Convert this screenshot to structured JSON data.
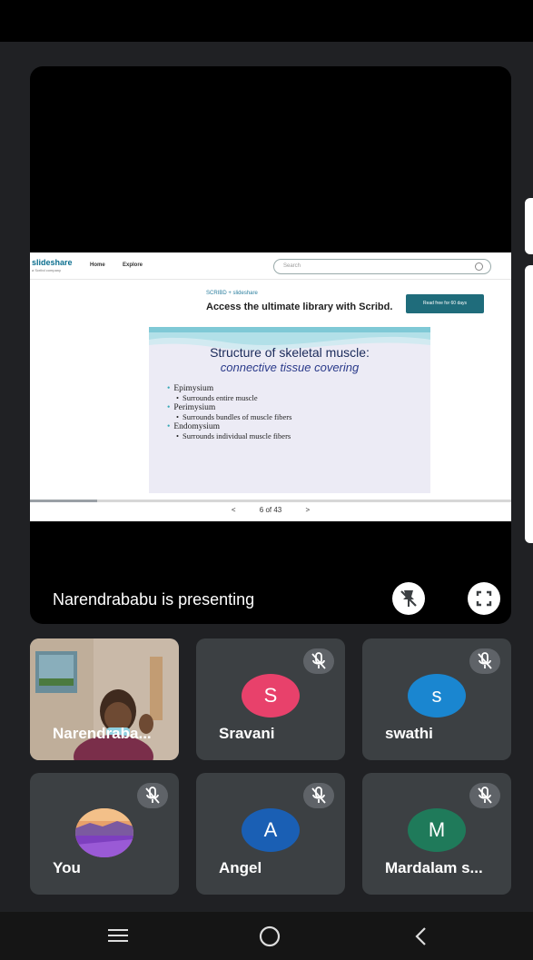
{
  "presentation": {
    "presenter_label": "Narendrababu is presenting",
    "slideshare": {
      "logo": "slideshare",
      "logo_sub": "a Scribd company",
      "nav_home": "Home",
      "nav_explore": "Explore",
      "search_placeholder": "Search"
    },
    "ad": {
      "brand": "SCRIBD + slideshare",
      "text": "Access the ultimate library with Scribd.",
      "button": "Read free for 60 days"
    },
    "slide": {
      "title": "Structure of skeletal muscle:",
      "subtitle": "connective tissue covering",
      "bullets": [
        {
          "main": "Epimysium",
          "sub": "Surrounds entire muscle"
        },
        {
          "main": "Perimysium",
          "sub": "Surrounds bundles of muscle fibers"
        },
        {
          "main": "Endomysium",
          "sub": "Surrounds individual muscle fibers"
        }
      ]
    },
    "pager": {
      "prev": "<",
      "page": "6 of 43",
      "next": ">"
    },
    "progress_fraction": 0.14
  },
  "participants": [
    {
      "name": "Narendraba...",
      "type": "video",
      "muted": false
    },
    {
      "name": "Sravani",
      "initial": "S",
      "color": "#e8416b",
      "muted": true
    },
    {
      "name": "swathi",
      "initial": "s",
      "color": "#1a86d0",
      "muted": true
    },
    {
      "name": "You",
      "type": "photo",
      "muted": true
    },
    {
      "name": "Angel",
      "initial": "A",
      "color": "#1a5fb4",
      "muted": true
    },
    {
      "name": "Mardalam s...",
      "initial": "M",
      "color": "#1f7a5a",
      "muted": true
    }
  ],
  "icons": {
    "pin": "unpin-icon",
    "fullscreen": "fullscreen-icon",
    "mute": "mic-off-icon",
    "nav_menu": "recent-apps-icon",
    "nav_home": "home-icon",
    "nav_back": "back-icon"
  }
}
